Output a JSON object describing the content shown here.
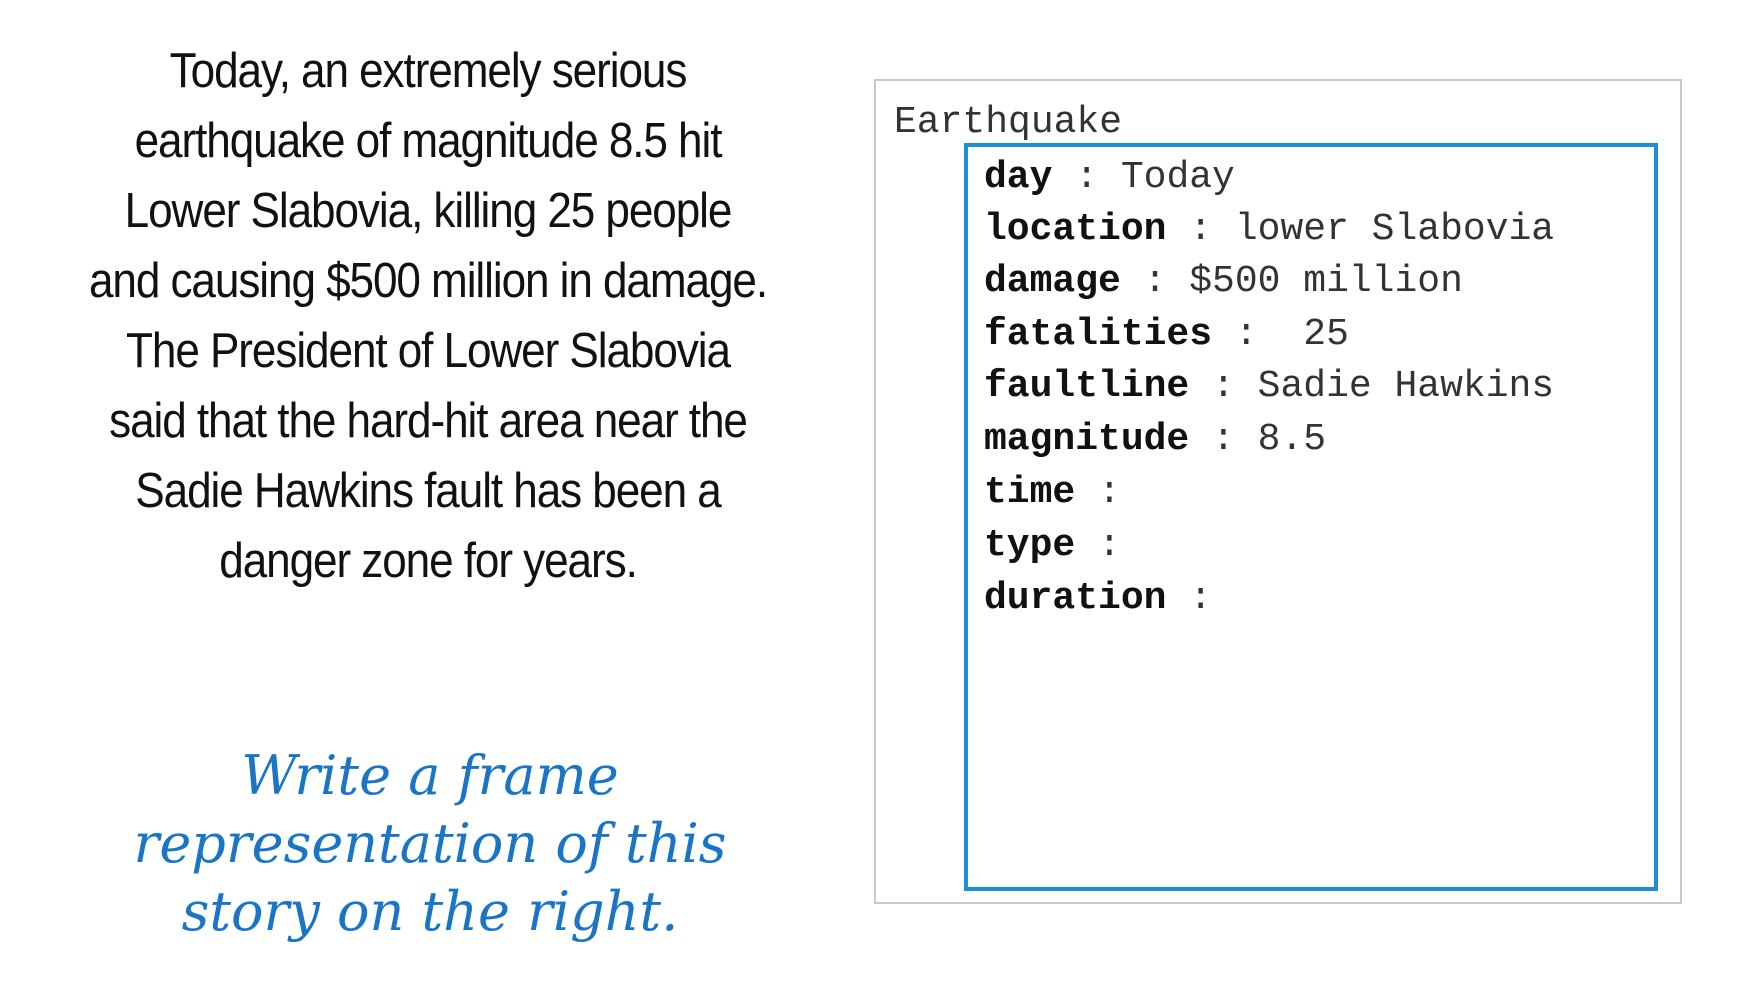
{
  "story": {
    "lines": [
      "Today, an extremely serious",
      "earthquake of magnitude 8.5 hit",
      "Lower Slabovia, killing 25 people",
      "and causing $500 million in damage.",
      "The President of Lower Slabovia",
      "said that the hard-hit area near the",
      "Sadie Hawkins fault has been a",
      "danger zone for years."
    ]
  },
  "instruction": {
    "lines": [
      "Write a frame",
      "representation of this",
      "story on the right."
    ],
    "color": "#1a75c7"
  },
  "frame": {
    "title": "Earthquake",
    "border_color": "#1c8fd6",
    "slots": [
      {
        "name": "day",
        "sep": " : ",
        "value": "Today"
      },
      {
        "name": "location",
        "sep": " : ",
        "value": "lower Slabovia"
      },
      {
        "name": "damage",
        "sep": " : ",
        "value": "$500 million"
      },
      {
        "name": "fatalities",
        "sep": " :  ",
        "value": "25"
      },
      {
        "name": "faultline",
        "sep": " : ",
        "value": "Sadie Hawkins"
      },
      {
        "name": "magnitude",
        "sep": " : ",
        "value": "8.5"
      },
      {
        "name": "time",
        "sep": " :",
        "value": ""
      },
      {
        "name": "type",
        "sep": " :",
        "value": ""
      },
      {
        "name": "duration",
        "sep": " :",
        "value": ""
      }
    ]
  }
}
